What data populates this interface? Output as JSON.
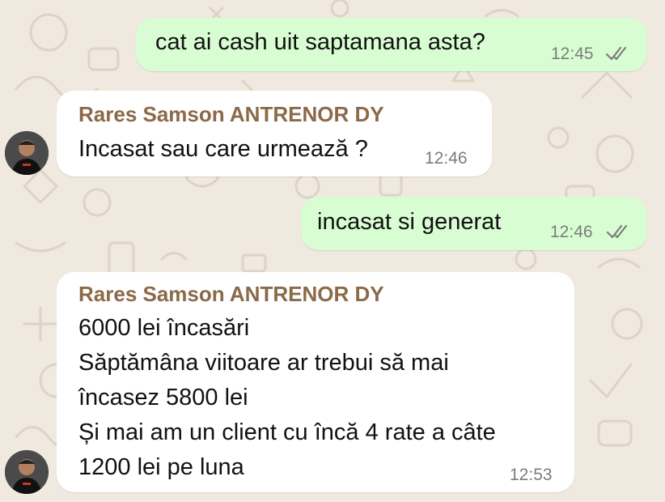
{
  "colors": {
    "chat_background": "#efe9df",
    "outgoing_bubble": "#d9fdd3",
    "incoming_bubble": "#ffffff",
    "sender_name": "#8a6a48",
    "timestamp": "#7c7c7c"
  },
  "messages": [
    {
      "direction": "outgoing",
      "text": "cat ai cash uit saptamana asta?",
      "time": "12:45",
      "status_icon": "double-check-icon"
    },
    {
      "direction": "incoming",
      "sender": "Rares Samson ANTRENOR DY",
      "text": "Incasat sau care urmează ?",
      "time": "12:46",
      "avatar_icon": "contact-avatar"
    },
    {
      "direction": "outgoing",
      "text": "incasat si generat",
      "time": "12:46",
      "status_icon": "double-check-icon"
    },
    {
      "direction": "incoming",
      "sender": "Rares Samson ANTRENOR DY",
      "lines": [
        "6000 lei încasări",
        "Săptămâna viitoare ar trebui să mai",
        "încasez 5800 lei",
        "Și mai am un client cu încă 4 rate a câte",
        "1200 lei pe luna"
      ],
      "time": "12:53",
      "avatar_icon": "contact-avatar"
    }
  ]
}
